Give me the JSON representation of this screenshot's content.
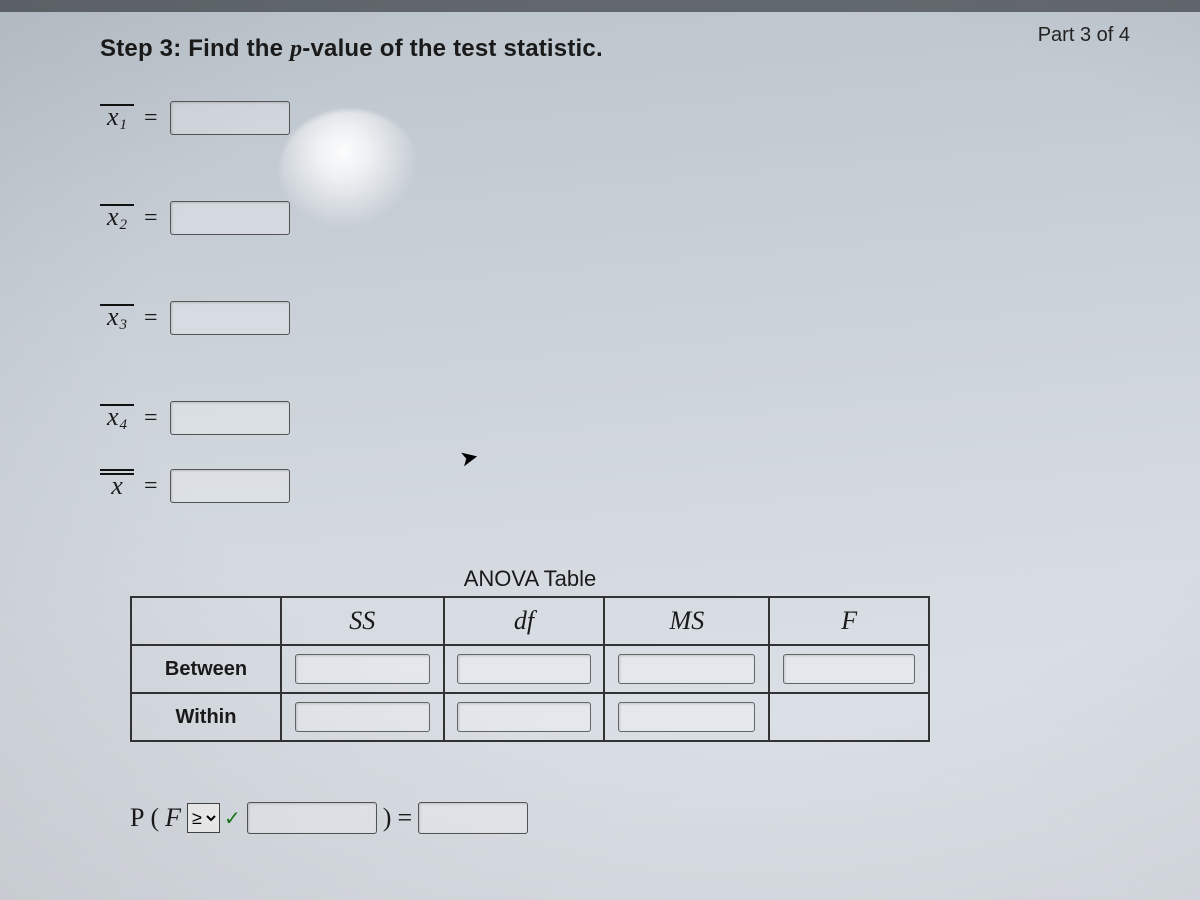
{
  "part_label": "Part 3 of 4",
  "step": {
    "prefix": "Step 3: Find the ",
    "var": "p",
    "suffix": "-value of the test statistic."
  },
  "means": [
    {
      "symbol": "x",
      "sub": "1",
      "dbl": false,
      "value": ""
    },
    {
      "symbol": "x",
      "sub": "2",
      "dbl": false,
      "value": ""
    },
    {
      "symbol": "x",
      "sub": "3",
      "dbl": false,
      "value": ""
    },
    {
      "symbol": "x",
      "sub": "4",
      "dbl": false,
      "value": ""
    },
    {
      "symbol": "x",
      "sub": "",
      "dbl": true,
      "value": ""
    }
  ],
  "eq_sign": "=",
  "anova": {
    "title": "ANOVA Table",
    "cols": [
      "SS",
      "df",
      "MS",
      "F"
    ],
    "rows": [
      {
        "label": "Between",
        "cells": [
          "",
          "",
          "",
          ""
        ]
      },
      {
        "label": "Within",
        "cells": [
          "",
          "",
          "",
          null
        ]
      }
    ]
  },
  "prob": {
    "P": "P",
    "open": "(",
    "F": "F",
    "op_selected": "≥",
    "op_options": [
      "≥",
      "≤",
      ">",
      "<",
      "="
    ],
    "check": "✓",
    "arg_value": "",
    "close": ")",
    "eq": "=",
    "result_value": ""
  }
}
